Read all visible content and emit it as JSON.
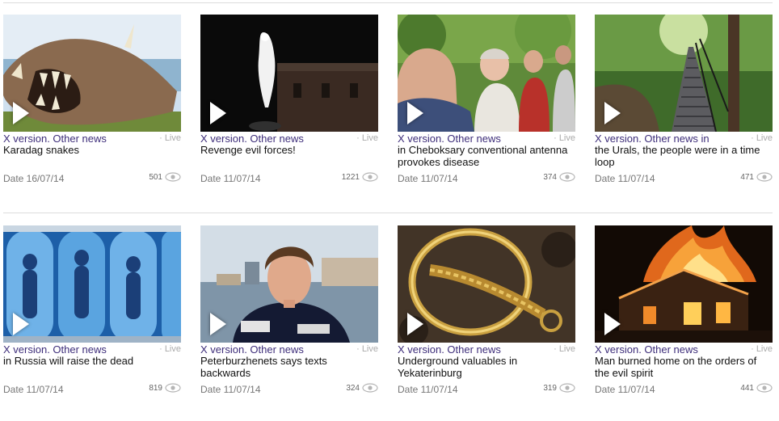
{
  "cards": [
    {
      "category": "X version. Other news",
      "live": "Live",
      "title": "Karadag snakes",
      "date": "Date 16/07/14",
      "views": "501"
    },
    {
      "category": "X version. Other news",
      "live": "Live",
      "title": "Revenge evil forces!",
      "date": "Date 11/07/14",
      "views": "1221"
    },
    {
      "category": "X version. Other news",
      "live": "Live",
      "title": "in Cheboksary conventional antenna provokes disease",
      "date": "Date 11/07/14",
      "views": "374"
    },
    {
      "category": "X version. Other news in",
      "live": "Live",
      "title": "the Urals, the people were in a time loop",
      "date": "Date 11/07/14",
      "views": "471"
    },
    {
      "category": "X version. Other news",
      "live": "Live",
      "title": "in Russia will raise the dead",
      "date": "Date 11/07/14",
      "views": "819"
    },
    {
      "category": "X version. Other news",
      "live": "Live",
      "title": "Peterburzhenets says texts backwards",
      "date": "Date 11/07/14",
      "views": "324"
    },
    {
      "category": "X version. Other news",
      "live": "Live",
      "title": "Underground valuables in Yekaterinburg",
      "date": "Date 11/07/14",
      "views": "319"
    },
    {
      "category": "X version. Other news",
      "live": "Live",
      "title": "Man burned home on the orders of the evil spirit",
      "date": "Date 11/07/14",
      "views": "441"
    }
  ],
  "icons": {
    "play": "play-icon",
    "views": "eye-icon"
  },
  "colors": {
    "category": "#3d2d7a",
    "muted": "#aaaaaa",
    "date": "#777777"
  }
}
